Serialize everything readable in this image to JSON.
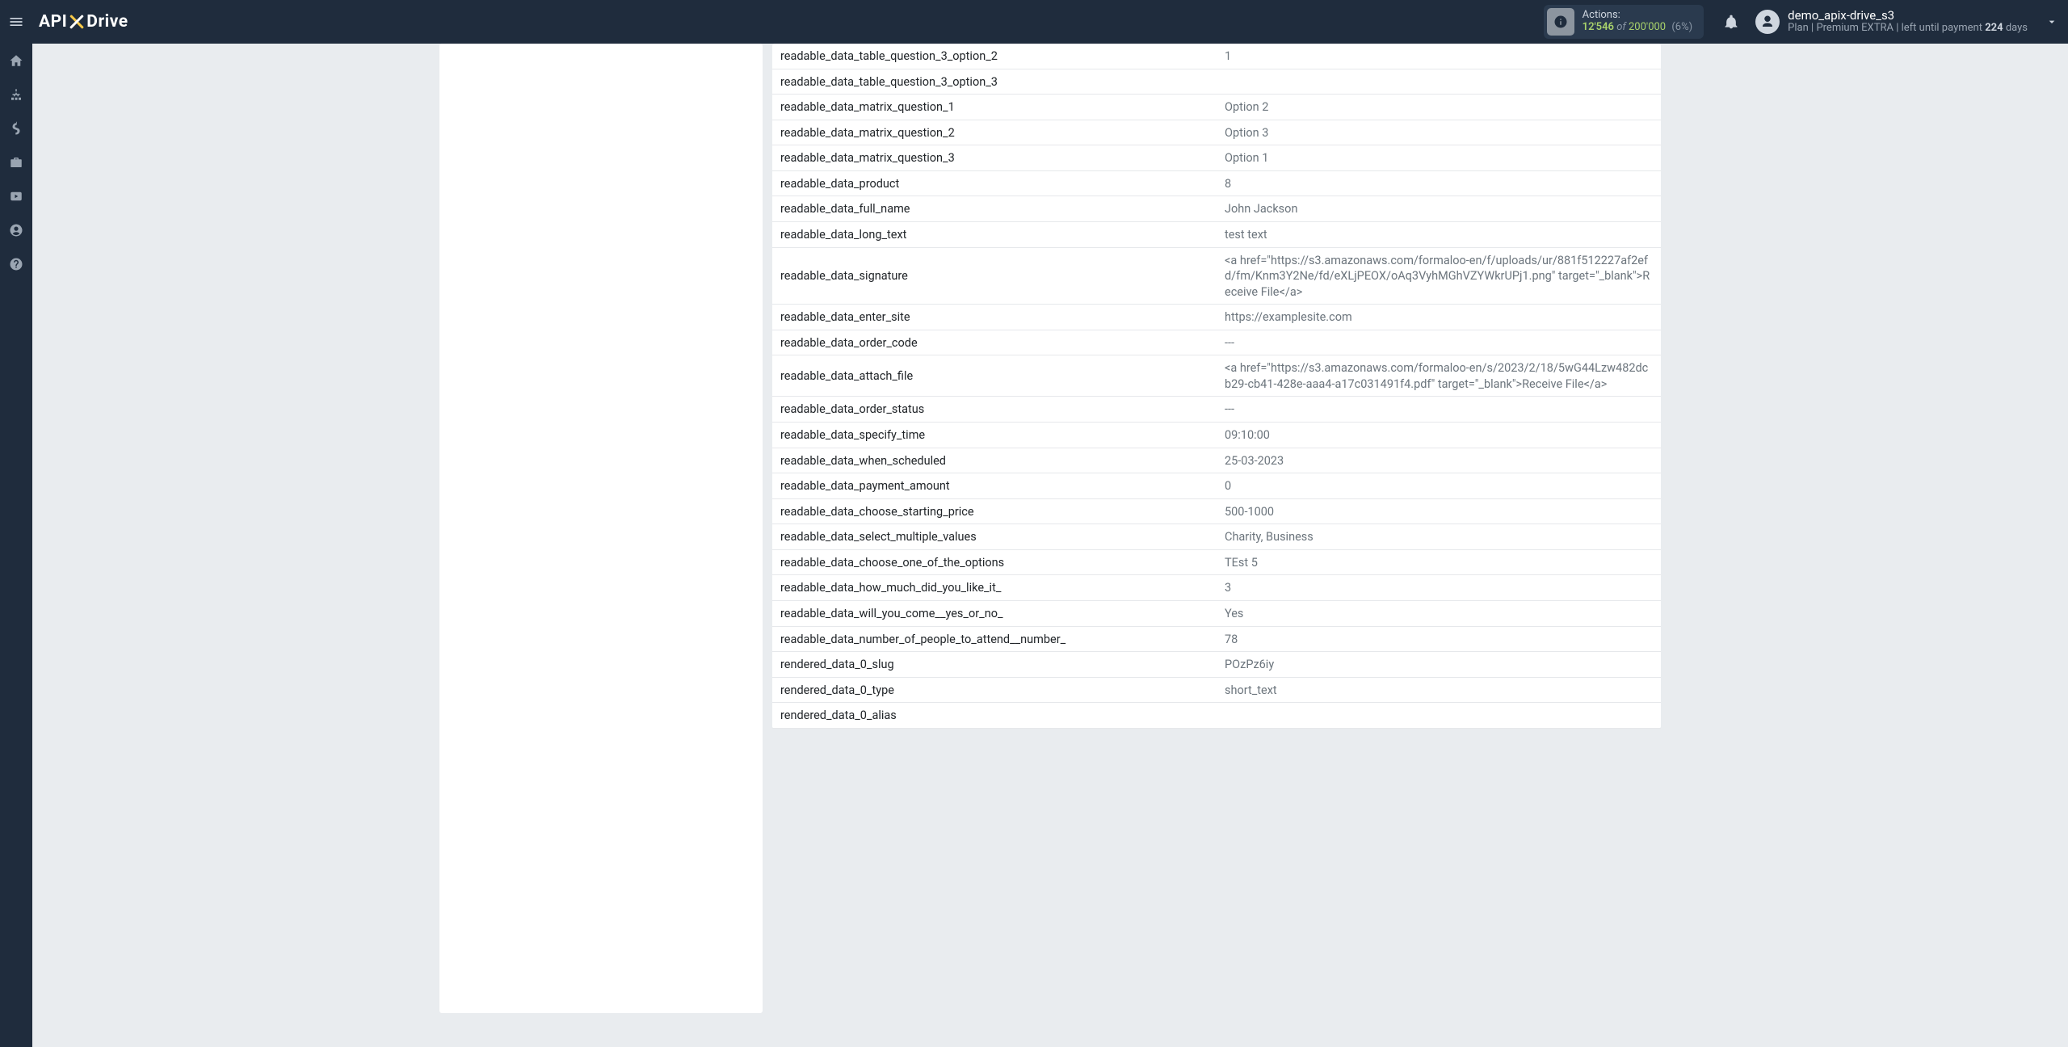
{
  "navbar": {
    "logo": {
      "api": "API",
      "drive": "Drive"
    },
    "actions": {
      "label": "Actions:",
      "count": "12'546",
      "of": "of",
      "max": "200'000",
      "pct": "(6%)"
    },
    "user": {
      "name": "demo_apix-drive_s3",
      "plan_word": "Plan",
      "plan_name": "Premium EXTRA",
      "left_word": "left until payment",
      "days_num": "224",
      "days_word": "days"
    }
  },
  "sidebar": {
    "items": [
      {
        "name": "home"
      },
      {
        "name": "integrations"
      },
      {
        "name": "billing"
      },
      {
        "name": "services"
      },
      {
        "name": "videos"
      },
      {
        "name": "account"
      },
      {
        "name": "help"
      }
    ]
  },
  "rows": [
    {
      "key": "readable_data_table_question_3_option_2",
      "val": "1"
    },
    {
      "key": "readable_data_table_question_3_option_3",
      "val": ""
    },
    {
      "key": "readable_data_matrix_question_1",
      "val": "Option 2"
    },
    {
      "key": "readable_data_matrix_question_2",
      "val": "Option 3"
    },
    {
      "key": "readable_data_matrix_question_3",
      "val": "Option 1"
    },
    {
      "key": "readable_data_product",
      "val": "8"
    },
    {
      "key": "readable_data_full_name",
      "val": "John Jackson"
    },
    {
      "key": "readable_data_long_text",
      "val": "test text"
    },
    {
      "key": "readable_data_signature",
      "val": "<a href=\"https://s3.amazonaws.com/formaloo-en/f/uploads/ur/881f512227af2efd/fm/Knm3Y2Ne/fd/eXLjPEOX/oAq3VyhMGhVZYWkrUPj1.png\" target=\"_blank\">Receive File</a>"
    },
    {
      "key": "readable_data_enter_site",
      "val": "https://examplesite.com"
    },
    {
      "key": "readable_data_order_code",
      "val": "---"
    },
    {
      "key": "readable_data_attach_file",
      "val": "<a href=\"https://s3.amazonaws.com/formaloo-en/s/2023/2/18/5wG44Lzw482dcb29-cb41-428e-aaa4-a17c031491f4.pdf\" target=\"_blank\">Receive File</a>"
    },
    {
      "key": "readable_data_order_status",
      "val": "---"
    },
    {
      "key": "readable_data_specify_time",
      "val": "09:10:00"
    },
    {
      "key": "readable_data_when_scheduled",
      "val": "25-03-2023"
    },
    {
      "key": "readable_data_payment_amount",
      "val": "0"
    },
    {
      "key": "readable_data_choose_starting_price",
      "val": "500-1000"
    },
    {
      "key": "readable_data_select_multiple_values",
      "val": "Charity, Business"
    },
    {
      "key": "readable_data_choose_one_of_the_options",
      "val": "TEst 5"
    },
    {
      "key": "readable_data_how_much_did_you_like_it_",
      "val": "3"
    },
    {
      "key": "readable_data_will_you_come__yes_or_no_",
      "val": "Yes"
    },
    {
      "key": "readable_data_number_of_people_to_attend__number_",
      "val": "78"
    },
    {
      "key": "rendered_data_0_slug",
      "val": "POzPz6iy"
    },
    {
      "key": "rendered_data_0_type",
      "val": "short_text"
    },
    {
      "key": "rendered_data_0_alias",
      "val": ""
    }
  ]
}
